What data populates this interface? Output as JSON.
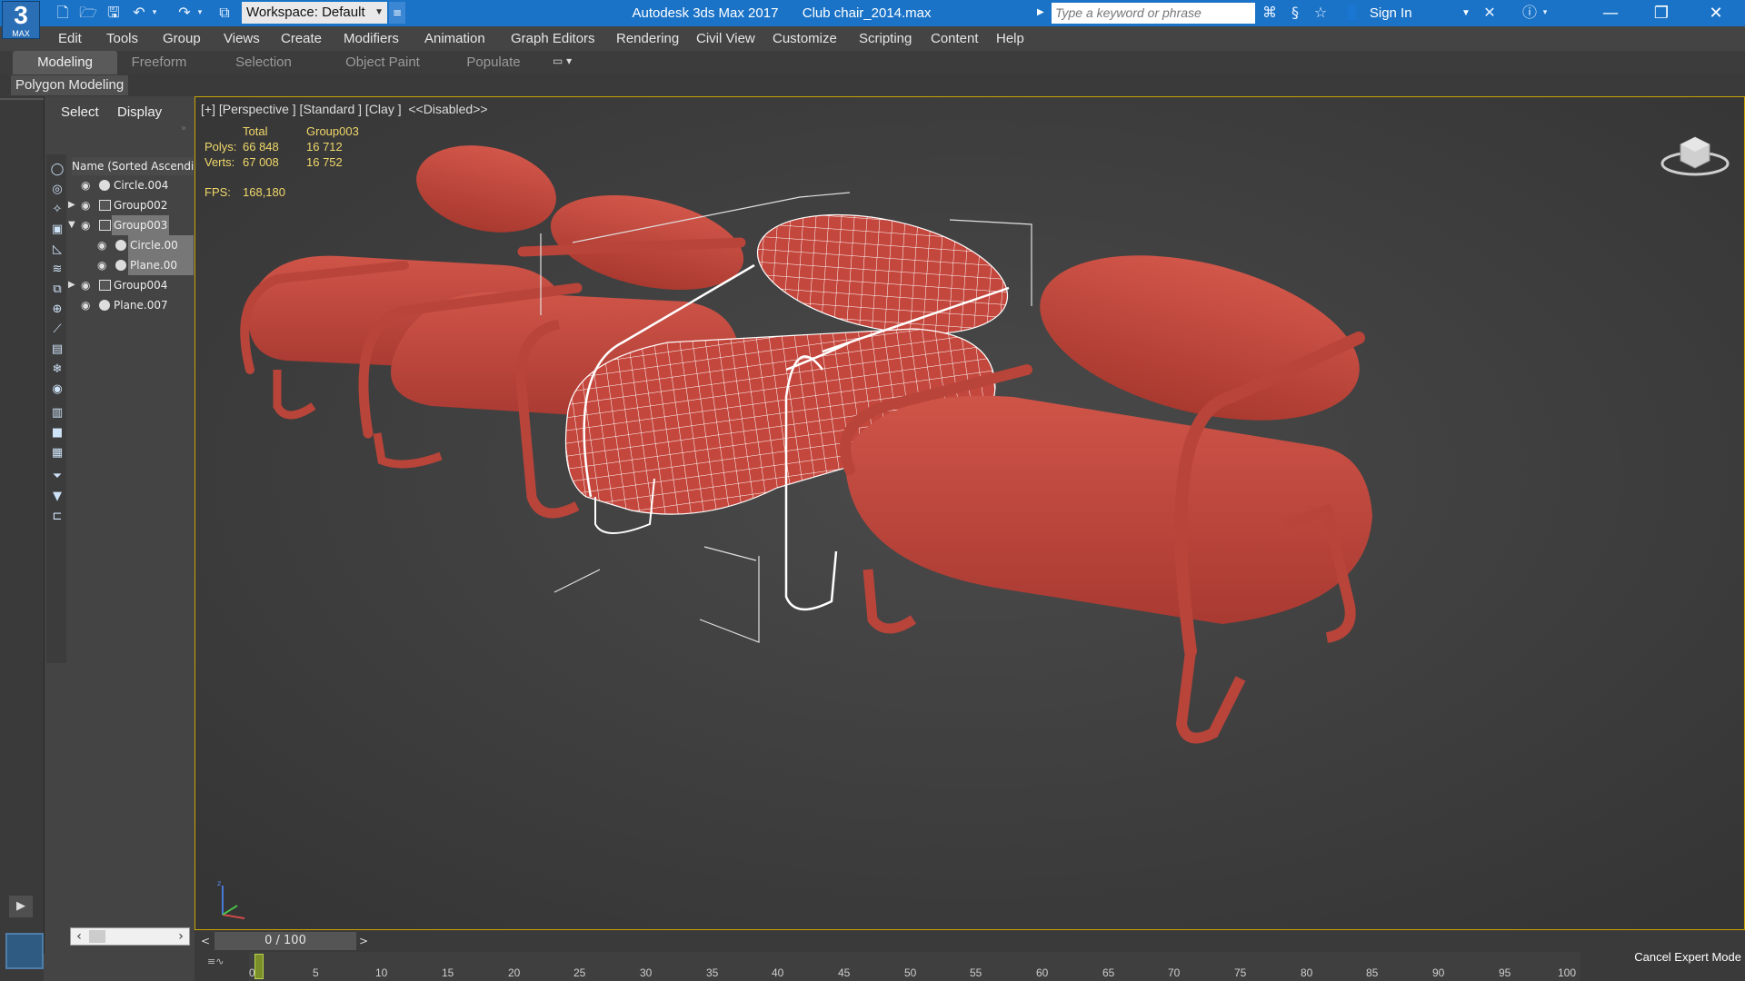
{
  "titlebar": {
    "logo_big": "3",
    "logo_small": "MAX",
    "workspace": "Workspace: Default",
    "app_name": "Autodesk 3ds Max 2017",
    "file_name": "Club chair_2014.max",
    "search_placeholder": "Type a keyword or phrase",
    "sign_in": "Sign In"
  },
  "menu": [
    "Edit",
    "Tools",
    "Group",
    "Views",
    "Create",
    "Modifiers",
    "Animation",
    "Graph Editors",
    "Rendering",
    "Civil View",
    "Customize",
    "Scripting",
    "Content",
    "Help"
  ],
  "ribbon": {
    "tabs": [
      "Modeling",
      "Freeform",
      "Selection",
      "Object Paint",
      "Populate"
    ],
    "active_tab": "Modeling",
    "panel_label": "Polygon Modeling"
  },
  "scene_explorer": {
    "tabs": [
      "Select",
      "Display"
    ],
    "column_header": "Name (Sorted Ascendi",
    "rows": [
      {
        "name": "Circle.004",
        "type": "object",
        "expand": "",
        "selected": false
      },
      {
        "name": "Group002",
        "type": "group",
        "expand": "▶",
        "selected": false
      },
      {
        "name": "Group003",
        "type": "group",
        "expand": "▼",
        "selected": true
      },
      {
        "name": "Circle.00",
        "type": "object",
        "expand": "",
        "selected": true
      },
      {
        "name": "Plane.00",
        "type": "object",
        "expand": "",
        "selected": true
      },
      {
        "name": "Group004",
        "type": "group",
        "expand": "▶",
        "selected": false
      },
      {
        "name": "Plane.007",
        "type": "object",
        "expand": "",
        "selected": false
      }
    ]
  },
  "viewport": {
    "label": "[+] [Perspective ] [Standard ] [Clay ]  <<Disabled>>",
    "stats": {
      "col_total": "Total",
      "col_selection": "Group003",
      "polys_label": "Polys:",
      "polys_total": "66 848",
      "polys_sel": "16 712",
      "verts_label": "Verts:",
      "verts_total": "67 008",
      "verts_sel": "16 752",
      "fps_label": "FPS:",
      "fps_value": "168,180"
    },
    "object_color": "#c4473d",
    "wire_color": "#ffffff"
  },
  "timeline": {
    "slider_text": "0 / 100",
    "prev": "<",
    "next": ">",
    "ticks": [
      "0",
      "5",
      "10",
      "15",
      "20",
      "25",
      "30",
      "35",
      "40",
      "45",
      "50",
      "55",
      "60",
      "65",
      "70",
      "75",
      "80",
      "85",
      "90",
      "95",
      "100"
    ],
    "cancel_expert": "Cancel Expert Mode"
  }
}
